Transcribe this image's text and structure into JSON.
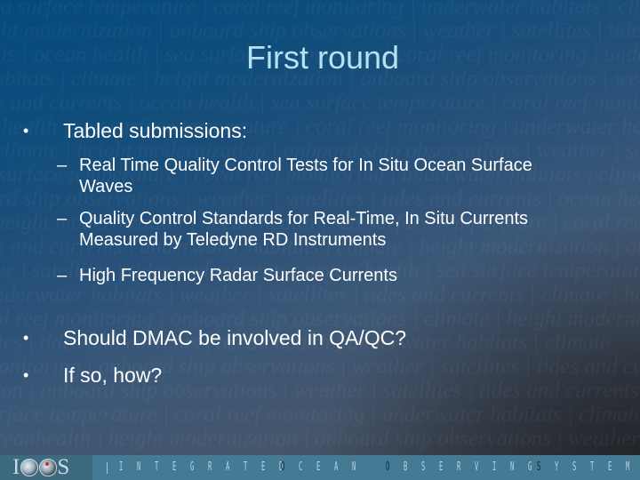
{
  "slide": {
    "title": "First round",
    "bullets": [
      {
        "text": "Tabled submissions:",
        "subitems": [
          "Real Time Quality Control Tests for In Situ Ocean Surface Waves",
          "Quality Control Standards for Real-Time, In Situ Currents Measured by Teledyne RD Instruments",
          "High Frequency Radar Surface Currents"
        ]
      },
      {
        "text": "Should DMAC be involved in QA/QC?"
      },
      {
        "text": "If so, how?"
      }
    ],
    "bullet_glyph": "•",
    "dash_glyph": "–"
  },
  "background_watermark": [
    "sea surface temperature | coral reef monitoring | underwater habitats | climate | height mo",
    "height modernization | onboard ship observations | weather | satellites | tides and currents",
    "currents | ocean health | sea surface temperature | coral reef monitoring | underwater",
    "habitats | climate | height modernization | onboard ship observations | weather | satellites",
    "tides and currents | ocean health | sea surface temperature | coral reef monitoring",
    "ocean health | sea surface temperature | coral reef monitoring | underwater habitats",
    "| climate | height modernization | onboard ship observations | weather | satellites",
    "sea surface temperature | coral reef monitoring | underwater habitats | climate | tides",
    "onboard ship observations | weather | satellites | tides and currents | ocean health",
    "| height modernization | ocean health | sea surface temperature | coral reef monitoring",
    "tides and currents | underwater habitats | climate | height modernization | onboard ship",
    "weather | satellites | tides and currents | ocean health | sea surface temperature",
    "underwater habitats | weather | satellites | tides and currents | climate | height",
    "coral reef monitoring | onboard ship observations | climate | height modernization",
    "satellites | tides and currents | ocean health | underwater habitats | climate",
    "monitoring | onboard ship observations | weather | satellites | tides and currents",
    "ization | onboard ship observations | weather | satellites | tides and currents | ocean",
    "sea surface temperature | coral reef monitoring | underwater habitats | climate | height",
    "oceanhealth | height modernization | onboard ship observations | weather"
  ],
  "footer": {
    "logo_text": "IOOS",
    "logo_letters": {
      "first": "I",
      "last": "S"
    },
    "tagline_letters": [
      {
        "ch": "I",
        "dark": false
      },
      {
        "ch": "N",
        "dark": false
      },
      {
        "ch": "T",
        "dark": false
      },
      {
        "ch": "E",
        "dark": false
      },
      {
        "ch": "G",
        "dark": false
      },
      {
        "ch": "R",
        "dark": false
      },
      {
        "ch": "A",
        "dark": false
      },
      {
        "ch": "T",
        "dark": false
      },
      {
        "ch": "E",
        "dark": false
      },
      {
        "ch": "D",
        "dark": false
      },
      {
        "ch": "O",
        "dark": true
      },
      {
        "ch": "C",
        "dark": false
      },
      {
        "ch": "E",
        "dark": false
      },
      {
        "ch": "A",
        "dark": false
      },
      {
        "ch": "N",
        "dark": false
      },
      {
        "ch": "O",
        "dark": true
      },
      {
        "ch": "B",
        "dark": false
      },
      {
        "ch": "S",
        "dark": false
      },
      {
        "ch": "E",
        "dark": false
      },
      {
        "ch": "R",
        "dark": false
      },
      {
        "ch": "V",
        "dark": false
      },
      {
        "ch": "I",
        "dark": false
      },
      {
        "ch": "N",
        "dark": false
      },
      {
        "ch": "G",
        "dark": false
      },
      {
        "ch": "S",
        "dark": true
      },
      {
        "ch": "Y",
        "dark": false
      },
      {
        "ch": "S",
        "dark": false
      },
      {
        "ch": "T",
        "dark": false
      },
      {
        "ch": "E",
        "dark": false
      },
      {
        "ch": "M",
        "dark": false
      }
    ],
    "tagline": "INTEGRATED OCEAN OBSERVING SYSTEM"
  },
  "colors": {
    "title": "#b6e3f3",
    "body_text": "#ffffff",
    "footer_band": "#457a94",
    "background_top": "#054a7c",
    "background_bottom": "#3e434d"
  }
}
